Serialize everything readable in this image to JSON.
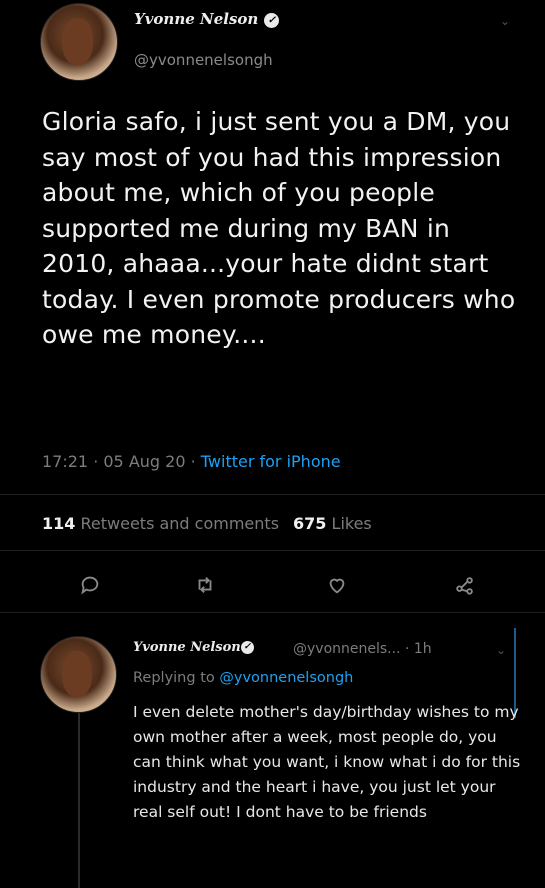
{
  "main_tweet": {
    "author_name": "Yvonne Nelson",
    "handle": "@yvonnenelsongh",
    "text": "Gloria safo, i just sent you a DM, you say most of you had this impression about me, which of you people supported me during my BAN in 2010, ahaaa...your hate didnt start today. I even promote producers who owe me money....",
    "time": "17:21",
    "date": "05 Aug 20",
    "client": "Twitter for iPhone",
    "retweets_count": "114",
    "retweets_label": "Retweets and comments",
    "likes_count": "675",
    "likes_label": "Likes"
  },
  "actions": {
    "reply_icon": "speech-bubble-icon",
    "retweet_icon": "retweet-icon",
    "like_icon": "heart-icon",
    "share_icon": "share-icon"
  },
  "reply_tweet": {
    "author_name": "Yvonne Nelson",
    "handle_time": "@yvonnenels... · 1h",
    "replying_prefix": "Replying to",
    "replying_to": "@yvonnenelsongh",
    "text": "I even delete mother's day/birthday wishes to my own mother after a week, most people do, you can think what you want, i know what i do for this industry and the heart i have, you just let your real self out! I dont have to be friends"
  },
  "colors": {
    "background": "#000000",
    "link": "#1da1f2",
    "muted": "#7c7c7c"
  }
}
